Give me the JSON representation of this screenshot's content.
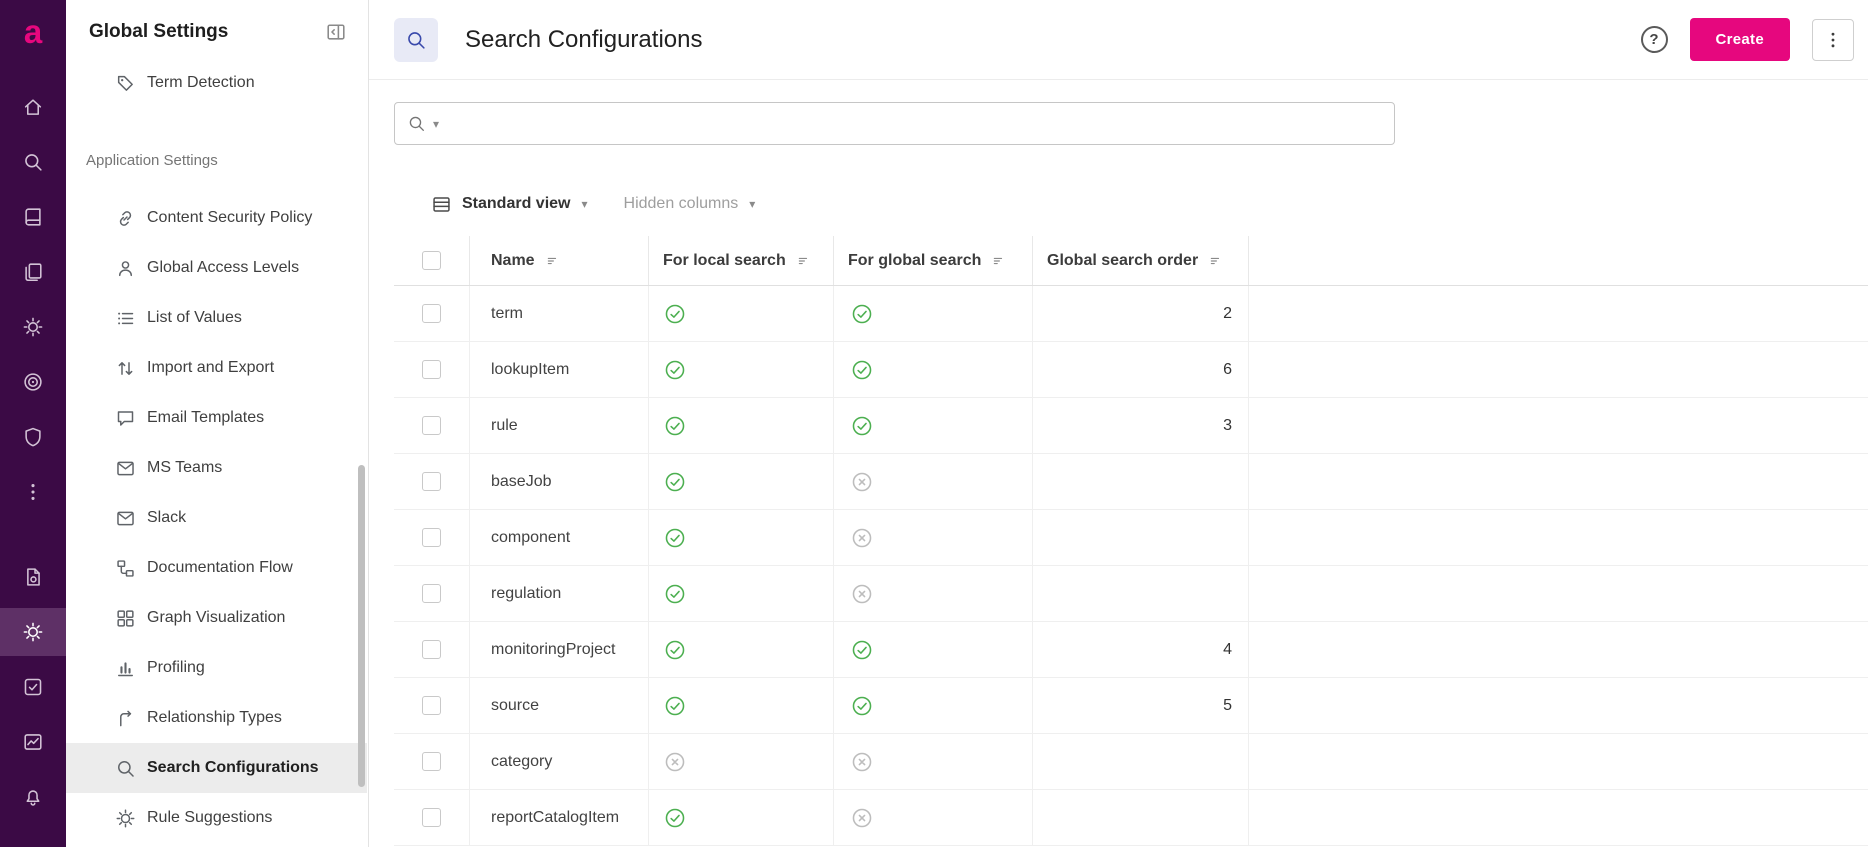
{
  "brand": {
    "logo_letter": "a"
  },
  "colors": {
    "accent_pink": "#E6077E",
    "rail_background": "#3B0A45",
    "success_green": "#4CAF50",
    "inactive_gray": "#BDBDBD",
    "selected_item_background": "#ECECEC",
    "title_icon_background": "#E8EAF6",
    "title_icon_foreground": "#3949AB"
  },
  "rail": {
    "icons_top": [
      "home-icon",
      "search-icon",
      "book-icon",
      "library-icon",
      "gear-icon",
      "target-icon",
      "shield-icon",
      "more-vertical-icon"
    ],
    "icons_bottom": [
      "document-icon",
      "settings-icon",
      "check-square-icon",
      "chart-icon",
      "bell-icon"
    ],
    "active_icon": "settings-icon"
  },
  "sidebar": {
    "title": "Global Settings",
    "scrolled_item": {
      "label": "Term Detection",
      "icon": "tag-icon"
    },
    "section_header": "Application Settings",
    "selected_item": "Search Configurations",
    "items": [
      {
        "label": "Content Security Policy",
        "icon": "link-icon"
      },
      {
        "label": "Global Access Levels",
        "icon": "person-icon"
      },
      {
        "label": "List of Values",
        "icon": "list-icon"
      },
      {
        "label": "Import and Export",
        "icon": "import-export-icon"
      },
      {
        "label": "Email Templates",
        "icon": "chat-icon"
      },
      {
        "label": "MS Teams",
        "icon": "mail-icon"
      },
      {
        "label": "Slack",
        "icon": "mail-icon"
      },
      {
        "label": "Documentation Flow",
        "icon": "flow-icon"
      },
      {
        "label": "Graph Visualization",
        "icon": "grid-icon"
      },
      {
        "label": "Profiling",
        "icon": "bar-chart-icon"
      },
      {
        "label": "Relationship Types",
        "icon": "relationship-icon"
      },
      {
        "label": "Search Configurations",
        "icon": "search-icon"
      },
      {
        "label": "Rule Suggestions",
        "icon": "gear-icon"
      }
    ]
  },
  "header": {
    "title": "Search Configurations",
    "title_icon": "search-icon",
    "help_label": "?",
    "create_button": "Create"
  },
  "search": {
    "value": "",
    "placeholder": ""
  },
  "toolbar": {
    "view_selector": "Standard view",
    "hidden_columns": "Hidden columns"
  },
  "table": {
    "columns": [
      "Name",
      "For local search",
      "For global search",
      "Global search order"
    ],
    "rows": [
      {
        "name": "term",
        "local_search": "yes",
        "global_search": "yes",
        "order": "2"
      },
      {
        "name": "lookupItem",
        "local_search": "yes",
        "global_search": "yes",
        "order": "6"
      },
      {
        "name": "rule",
        "local_search": "yes",
        "global_search": "yes",
        "order": "3"
      },
      {
        "name": "baseJob",
        "local_search": "yes",
        "global_search": "no",
        "order": ""
      },
      {
        "name": "component",
        "local_search": "yes",
        "global_search": "no",
        "order": ""
      },
      {
        "name": "regulation",
        "local_search": "yes",
        "global_search": "no",
        "order": ""
      },
      {
        "name": "monitoringProject",
        "local_search": "yes",
        "global_search": "yes",
        "order": "4"
      },
      {
        "name": "source",
        "local_search": "yes",
        "global_search": "yes",
        "order": "5"
      },
      {
        "name": "category",
        "local_search": "no",
        "global_search": "no",
        "order": ""
      },
      {
        "name": "reportCatalogItem",
        "local_search": "yes",
        "global_search": "no",
        "order": ""
      }
    ]
  }
}
